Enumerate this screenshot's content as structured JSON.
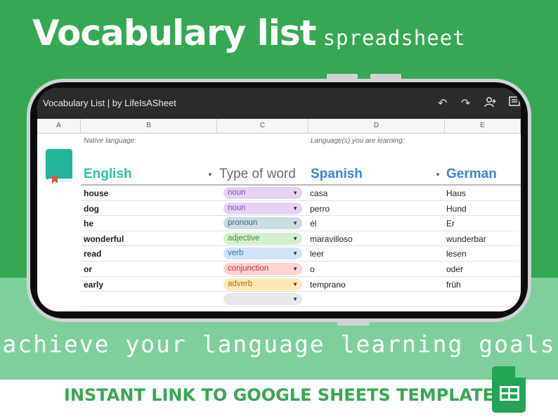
{
  "headline": {
    "big": "Vocabulary list",
    "small": "spreadsheet"
  },
  "app": {
    "title": "Vocabulary List | by LifeIsASheet",
    "icons": [
      "undo-icon",
      "redo-icon",
      "add-person-icon",
      "comment-icon"
    ]
  },
  "columns": [
    "A",
    "B",
    "C",
    "D",
    "E"
  ],
  "notes": {
    "native": "Native language:",
    "learning": "Language(s) you are learning:"
  },
  "headers": {
    "english": "English",
    "type": "Type of word",
    "spanish": "Spanish",
    "german": "German"
  },
  "rows": [
    {
      "english": "house",
      "type": "noun",
      "spanish": "casa",
      "german": "Haus"
    },
    {
      "english": "dog",
      "type": "noun",
      "spanish": "perro",
      "german": "Hund"
    },
    {
      "english": "he",
      "type": "pronoun",
      "spanish": "él",
      "german": "Er"
    },
    {
      "english": "wonderful",
      "type": "adjective",
      "spanish": "maravilloso",
      "german": "wunderbar"
    },
    {
      "english": "read",
      "type": "verb",
      "spanish": "leer",
      "german": "lesen"
    },
    {
      "english": "or",
      "type": "conjunction",
      "spanish": "o",
      "german": "oder"
    },
    {
      "english": "early",
      "type": "adverb",
      "spanish": "temprano",
      "german": "früh"
    },
    {
      "english": "",
      "type": "",
      "spanish": "",
      "german": ""
    }
  ],
  "chip_colors": {
    "noun": {
      "bg": "#e7d2f5",
      "fg": "#7e4ab0"
    },
    "pronoun": {
      "bg": "#c9dde3",
      "fg": "#3f6878"
    },
    "adjective": {
      "bg": "#d5f0cf",
      "fg": "#3e8c3a"
    },
    "verb": {
      "bg": "#cfe5f7",
      "fg": "#3a72b0"
    },
    "conjunction": {
      "bg": "#fbd3d1",
      "fg": "#c0362d"
    },
    "adverb": {
      "bg": "#fde8b4",
      "fg": "#a77900"
    },
    "empty": {
      "bg": "#e8e8e8",
      "fg": "#333333"
    }
  },
  "tagline": "achieve your language learning goals",
  "cta": "INSTANT LINK TO GOOGLE SHEETS TEMPLATE",
  "brand": {
    "green": "#36a853",
    "light_green": "#7fcf9d"
  }
}
